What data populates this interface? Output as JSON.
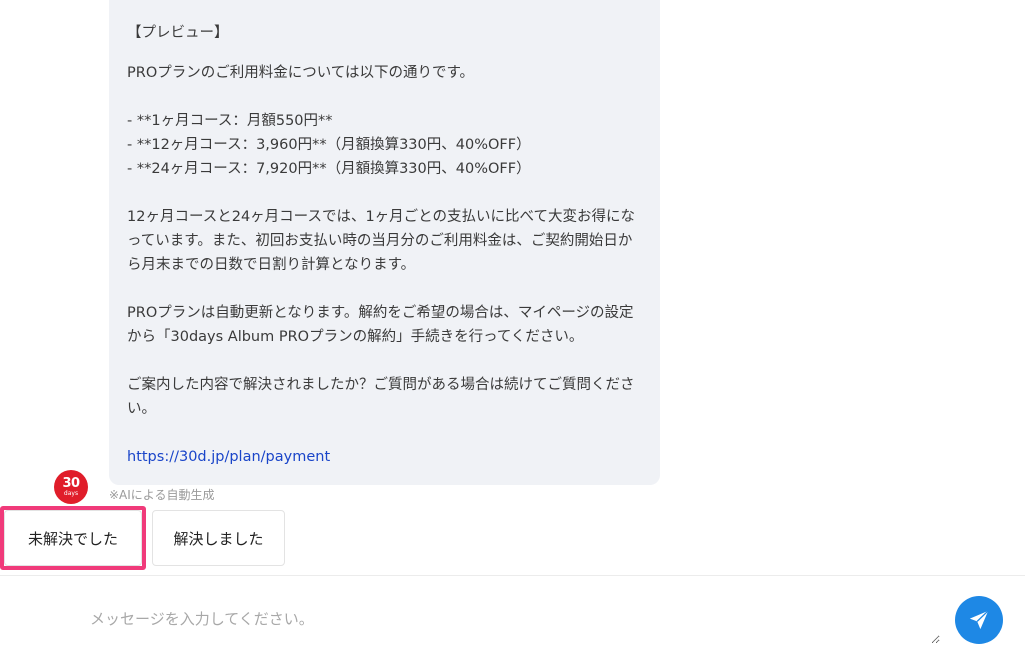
{
  "message": {
    "lines_block1": [
      "【プレビュー】"
    ],
    "intro": "PROプランのご利用料金については以下の通りです。",
    "plans": [
      "- **1ヶ月コース：月額550円**",
      "- **12ヶ月コース：3,960円**（月額換算330円、40%OFF）",
      "- **24ヶ月コース：7,920円**（月額換算330円、40%OFF）"
    ],
    "paragraph_discount": "12ヶ月コースと24ヶ月コースでは、1ヶ月ごとの支払いに比べて大変お得になっています。また、初回お支払い時の当月分のご利用料金は、ご契約開始日から月末までの日数で日割り計算となります。",
    "paragraph_renewal": "PROプランは自動更新となります。解約をご希望の場合は、マイページの設定から「30days Album PROプランの解約」手続きを行ってください。",
    "paragraph_question": "ご案内した内容で解決されましたか？ご質問がある場合は続けてご質問ください。",
    "link": "https://30d.jp/plan/payment"
  },
  "logo": {
    "number": "30",
    "text": "days",
    "color": "#e01d2a"
  },
  "ai_note": "※AIによる自動生成",
  "buttons": {
    "unresolved": "未解決でした",
    "resolved": "解決しました"
  },
  "highlight_color": "#f03a7a",
  "input": {
    "placeholder": "メッセージを入力してください。",
    "value": ""
  },
  "send": {
    "icon": "send-icon",
    "color": "#1e88e5"
  }
}
